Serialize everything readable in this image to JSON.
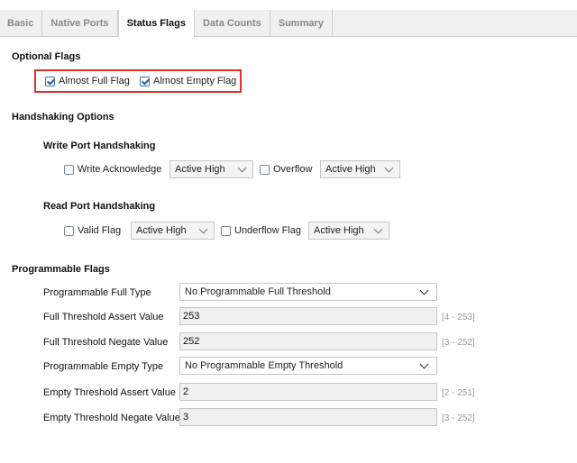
{
  "tabs": [
    {
      "label": "Basic"
    },
    {
      "label": "Native Ports"
    },
    {
      "label": "Status Flags"
    },
    {
      "label": "Data Counts"
    },
    {
      "label": "Summary"
    }
  ],
  "active_tab": "Status Flags",
  "optional_flags": {
    "title": "Optional Flags",
    "almost_full": {
      "label": "Almost Full Flag",
      "checked": true
    },
    "almost_empty": {
      "label": "Almost Empty Flag",
      "checked": true
    }
  },
  "handshaking": {
    "title": "Handshaking Options",
    "write": {
      "title": "Write Port Handshaking",
      "write_ack": {
        "label": "Write Acknowledge",
        "checked": false,
        "polarity": "Active High"
      },
      "overflow": {
        "label": "Overflow",
        "checked": false,
        "polarity": "Active High"
      }
    },
    "read": {
      "title": "Read Port Handshaking",
      "valid": {
        "label": "Valid Flag",
        "checked": false,
        "polarity": "Active High"
      },
      "underflow": {
        "label": "Underflow Flag",
        "checked": false,
        "polarity": "Active High"
      }
    }
  },
  "programmable": {
    "title": "Programmable Flags",
    "full_type": {
      "label": "Programmable Full Type",
      "value": "No Programmable Full Threshold"
    },
    "full_assert": {
      "label": "Full Threshold Assert Value",
      "value": "253",
      "range": "[4 - 253]"
    },
    "full_negate": {
      "label": "Full Threshold Negate Value",
      "value": "252",
      "range": "[3 - 252]"
    },
    "empty_type": {
      "label": "Programmable Empty Type",
      "value": "No Programmable Empty Threshold"
    },
    "empty_assert": {
      "label": "Empty Threshold Assert Value",
      "value": "2",
      "range": "[2 - 251]"
    },
    "empty_negate": {
      "label": "Empty Threshold Negate Value",
      "value": "3",
      "range": "[3 - 252]"
    }
  },
  "colors": {
    "highlight": "#e0302b",
    "tab_bar": "#f0f0f0"
  }
}
